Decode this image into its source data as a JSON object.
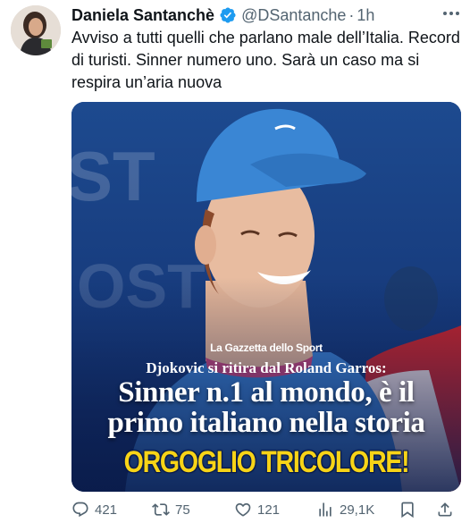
{
  "tweet": {
    "author_name": "Daniela Santanchè",
    "handle": "@DSantanche",
    "separator": "·",
    "time": "1h",
    "text": "Avviso a tutti quelli che parlano male dell’Italia. Record di turisti. Sinner numero uno. Sarà un caso ma si respira un’aria nuova"
  },
  "media": {
    "brand": "La Gazzetta dello Sport",
    "kicker": "Djokovic si ritira dal Roland Garros:",
    "headline_line1": "Sinner n.1 al mondo, è il",
    "headline_line2": "primo italiano nella storia",
    "banner": "ORGOGLIO TRICOLORE!"
  },
  "actions": {
    "replies": "421",
    "reposts": "75",
    "likes": "121",
    "views": "29,1K"
  },
  "colors": {
    "text": "#0f1419",
    "secondary": "#536471",
    "verified": "#1d9bf0",
    "banner": "#f7d417",
    "cap": "#3a86d4"
  },
  "icons": [
    "verified-badge-icon",
    "more-icon",
    "reply-icon",
    "repost-icon",
    "like-icon",
    "views-icon",
    "bookmark-icon",
    "share-icon"
  ]
}
